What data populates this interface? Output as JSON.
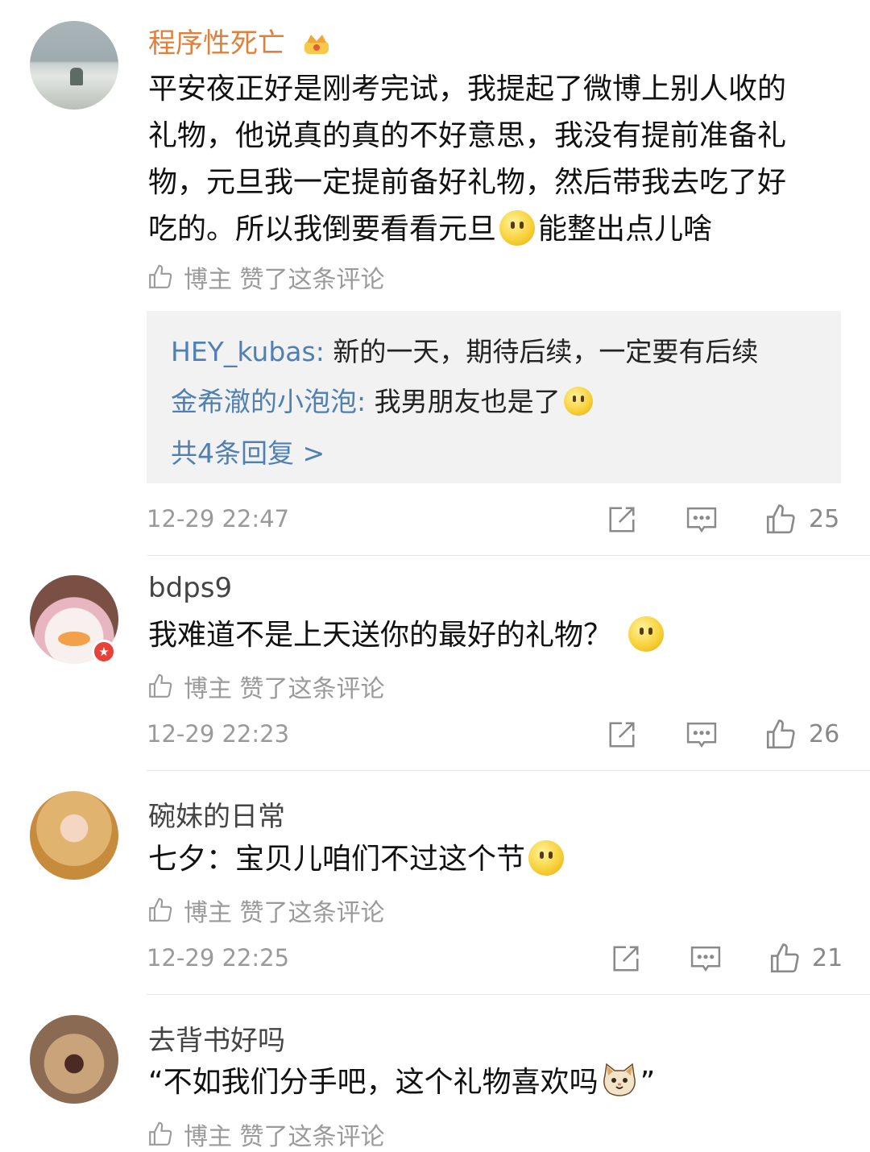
{
  "comments": [
    {
      "username": "程序性死亡",
      "content_lines": [
        "平安夜正好是刚考完试，我提起了微博上别人收的",
        "礼物，他说真的真的不好意思，我没有提前准备礼",
        "物，元旦我一定提前备好礼物，然后带我去吃了好"
      ],
      "content_last_a": "吃的。所以我倒要看看元旦",
      "content_last_b": "能整出点儿啥",
      "liked_text": "博主 赞了这条评论",
      "replies": [
        {
          "name": "HEY_kubas",
          "sep": ": ",
          "text": "新的一天，期待后续，一定要有后续"
        },
        {
          "name": "金希澈的小泡泡",
          "sep": ": ",
          "text": "我男朋友也是了"
        }
      ],
      "more_replies": "共4条回复 >",
      "time": "12-29 22:47",
      "likes": "25"
    },
    {
      "username": "bdps9",
      "content": "我难道不是上天送你的最好的礼物？",
      "liked_text": "博主 赞了这条评论",
      "time": "12-29 22:23",
      "likes": "26"
    },
    {
      "username": "碗妹的日常",
      "content": "七夕：宝贝儿咱们不过这个节",
      "liked_text": "博主 赞了这条评论",
      "time": "12-29 22:25",
      "likes": "21"
    },
    {
      "username": "去背书好吗",
      "content": "“不如我们分手吧，这个礼物喜欢吗",
      "content_end": "”",
      "liked_text": "博主 赞了这条评论"
    }
  ],
  "icons": {
    "thumb": "thumb-up-icon",
    "share": "share-icon",
    "comment": "comment-icon",
    "vip": "vip-crown-icon",
    "emoji": "smile-emoji",
    "cat": "cat-emoji"
  }
}
